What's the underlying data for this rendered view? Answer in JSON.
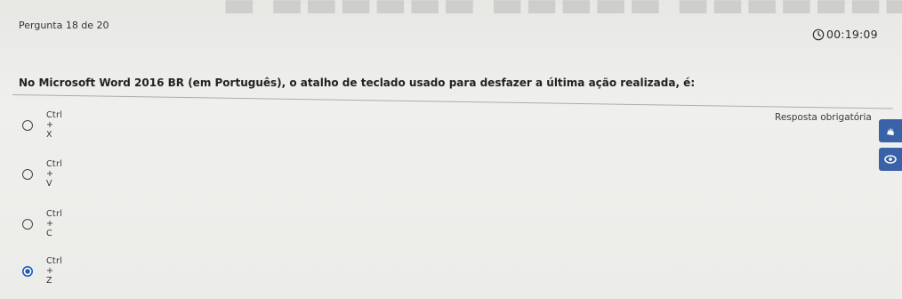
{
  "header": {
    "question_counter": "Pergunta 18 de 20",
    "timer": "00:19:09",
    "timer_icon": "clock-icon"
  },
  "question": {
    "text": "No Microsoft Word 2016 BR (em Português), o atalho de teclado usado para desfazer a última ação realizada, é:",
    "required_label": "Resposta obrigatória"
  },
  "options": [
    {
      "label": "Ctrl + X",
      "selected": false
    },
    {
      "label": "Ctrl + V",
      "selected": false
    },
    {
      "label": "Ctrl + C",
      "selected": false
    },
    {
      "label": "Ctrl + Z",
      "selected": true
    }
  ],
  "side_widgets": [
    {
      "icon": "sign-language-icon"
    },
    {
      "icon": "eye-icon"
    }
  ],
  "colors": {
    "background": "#ededeb",
    "accent": "#3a62a8",
    "radio_selected": "#1a5fb4",
    "text": "#222222"
  }
}
